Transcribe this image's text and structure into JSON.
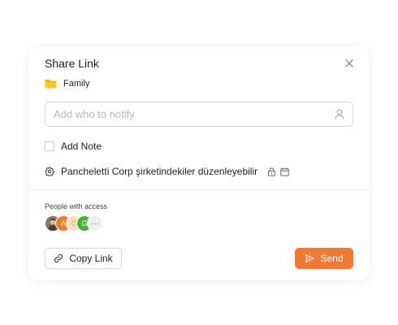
{
  "dialog": {
    "title": "Share Link",
    "folder_name": "Family",
    "search_placeholder": "Add who to notify",
    "note_label": "Add Note",
    "permission_text": "Pancheletti Corp şirketindekiler düzenleyebilir",
    "access_label": "People with access",
    "avatars": [
      {
        "type": "photo",
        "initial": ""
      },
      {
        "type": "initial",
        "initial": "A"
      },
      {
        "type": "initial",
        "initial": "C"
      },
      {
        "type": "initial",
        "initial": "G"
      },
      {
        "type": "more",
        "initial": "···"
      }
    ],
    "copy_label": "Copy Link",
    "send_label": "Send"
  },
  "colors": {
    "accent": "#f07a33",
    "folder": "#f7b500"
  },
  "icons": [
    "close-icon",
    "folder-icon",
    "user-icon",
    "gear-icon",
    "lock-icon",
    "calendar-icon",
    "link-icon",
    "send-icon"
  ]
}
